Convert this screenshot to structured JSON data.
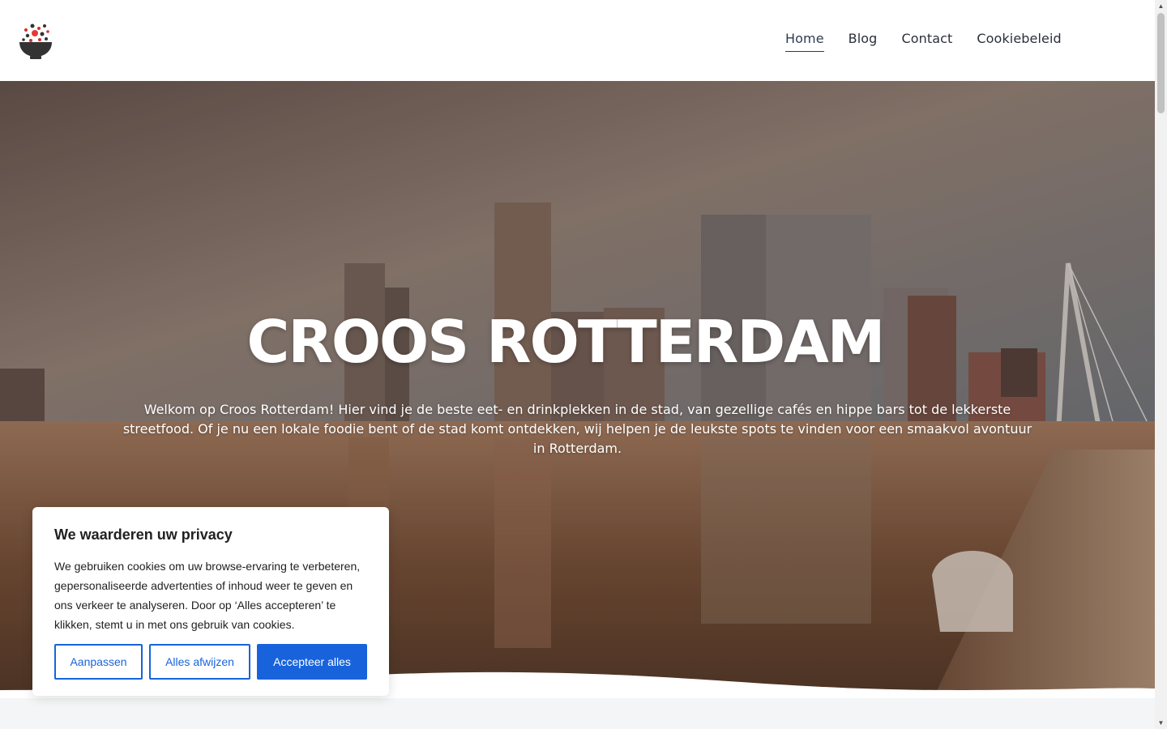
{
  "header": {
    "logo_name": "bowl-logo",
    "nav": [
      {
        "label": "Home",
        "active": true
      },
      {
        "label": "Blog",
        "active": false
      },
      {
        "label": "Contact",
        "active": false
      },
      {
        "label": "Cookiebeleid",
        "active": false
      }
    ]
  },
  "hero": {
    "title": "CROOS ROTTERDAM",
    "text": "Welkom op Croos Rotterdam! Hier vind je de beste eet- en drinkplekken in de stad, van gezellige cafés en hippe bars tot de lekkerste streetfood. Of je nu een lokale foodie bent of de stad komt ontdekken, wij helpen je de leukste spots te vinden voor een smaakvol avontuur in Rotterdam."
  },
  "cookie_banner": {
    "title": "We waarderen uw privacy",
    "text": "We gebruiken cookies om uw browse-ervaring te verbeteren, gepersonaliseerde advertenties of inhoud weer te geven en ons verkeer te analyseren. Door op ‘Alles accepteren’ te klikken, stemt u in met ons gebruik van cookies.",
    "customize_label": "Aanpassen",
    "reject_label": "Alles afwijzen",
    "accept_label": "Accepteer alles"
  },
  "colors": {
    "accent": "#1863dc",
    "nav_text": "#2b2f3a"
  }
}
